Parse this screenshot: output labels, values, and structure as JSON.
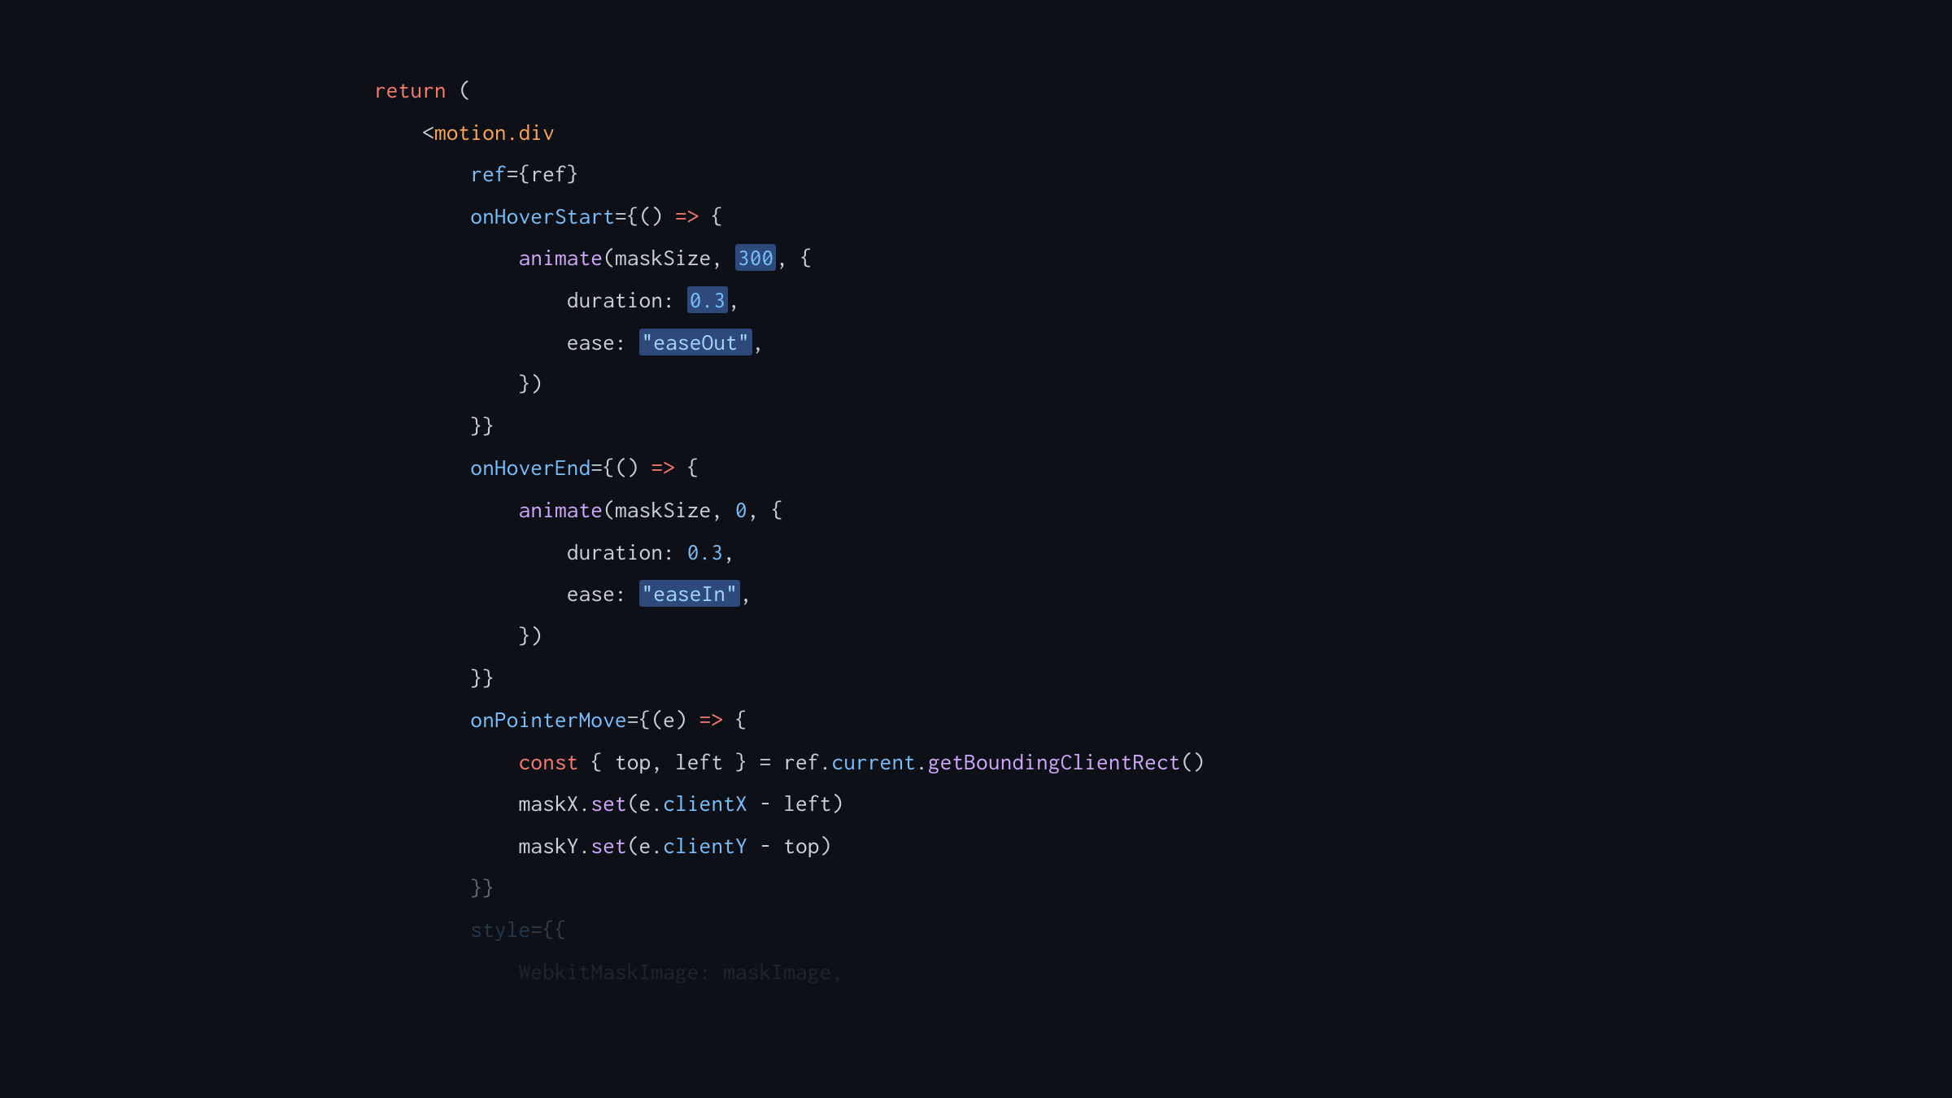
{
  "code": {
    "line1_return": "return",
    "line1_paren": " (",
    "line2_open": "<",
    "line2_component": "motion.div",
    "line3_attr": "ref",
    "line3_eq": "=",
    "line3_bopen": "{",
    "line3_var": "ref",
    "line3_bclose": "}",
    "line4_attr": "onHoverStart",
    "line4_eq": "=",
    "line4_bopen": "{",
    "line4_paren": "() ",
    "line4_arrow": "=>",
    "line4_bopen2": " {",
    "line5_fn": "animate",
    "line5_paren": "(",
    "line5_arg1": "maskSize",
    "line5_c1": ", ",
    "line5_num": "300",
    "line5_c2": ", ",
    "line5_bopen": "{",
    "line6_prop": "duration",
    "line6_colon": ": ",
    "line6_num": "0.3",
    "line6_comma": ",",
    "line7_prop": "ease",
    "line7_colon": ": ",
    "line7_str": "\"easeOut\"",
    "line7_comma": ",",
    "line8_close": "})",
    "line9_close": "}",
    "line9_close2": "}",
    "line10_attr": "onHoverEnd",
    "line10_eq": "=",
    "line10_bopen": "{",
    "line10_paren": "() ",
    "line10_arrow": "=>",
    "line10_bopen2": " {",
    "line11_fn": "animate",
    "line11_paren": "(",
    "line11_arg1": "maskSize",
    "line11_c1": ", ",
    "line11_num": "0",
    "line11_c2": ", ",
    "line11_bopen": "{",
    "line12_prop": "duration",
    "line12_colon": ": ",
    "line12_num": "0.3",
    "line12_comma": ",",
    "line13_prop": "ease",
    "line13_colon": ": ",
    "line13_str": "\"easeIn\"",
    "line13_comma": ",",
    "line14_close": "})",
    "line15_close": "}",
    "line15_close2": "}",
    "line16_attr": "onPointerMove",
    "line16_eq": "=",
    "line16_bopen": "{",
    "line16_paren": "(",
    "line16_param": "e",
    "line16_paren2": ") ",
    "line16_arrow": "=>",
    "line16_bopen2": " {",
    "line17_const": "const",
    "line17_dstart": " { ",
    "line17_var1": "top",
    "line17_c1": ", ",
    "line17_var2": "left",
    "line17_dend": " } ",
    "line17_eq": "= ",
    "line17_ref": "ref",
    "line17_dot1": ".",
    "line17_current": "current",
    "line17_dot2": ".",
    "line17_method": "getBoundingClientRect",
    "line17_call": "()",
    "line18_var": "maskX",
    "line18_dot": ".",
    "line18_method": "set",
    "line18_paren": "(",
    "line18_e": "e",
    "line18_dot2": ".",
    "line18_member": "clientX",
    "line18_op": " - ",
    "line18_var2": "left",
    "line18_paren2": ")",
    "line19_var": "maskY",
    "line19_dot": ".",
    "line19_method": "set",
    "line19_paren": "(",
    "line19_e": "e",
    "line19_dot2": ".",
    "line19_member": "clientY",
    "line19_op": " - ",
    "line19_var2": "top",
    "line19_paren2": ")",
    "line20_close": "}",
    "line20_close2": "}",
    "line21_attr": "style",
    "line21_eq": "=",
    "line21_bopen": "{{",
    "line22_prop": "WebkitMaskImage",
    "line22_colon": ": ",
    "line22_var": "maskImage",
    "line22_comma": ","
  },
  "indent": {
    "i0": "",
    "i1": "    ",
    "i2": "        ",
    "i3": "            ",
    "i4": "                "
  }
}
